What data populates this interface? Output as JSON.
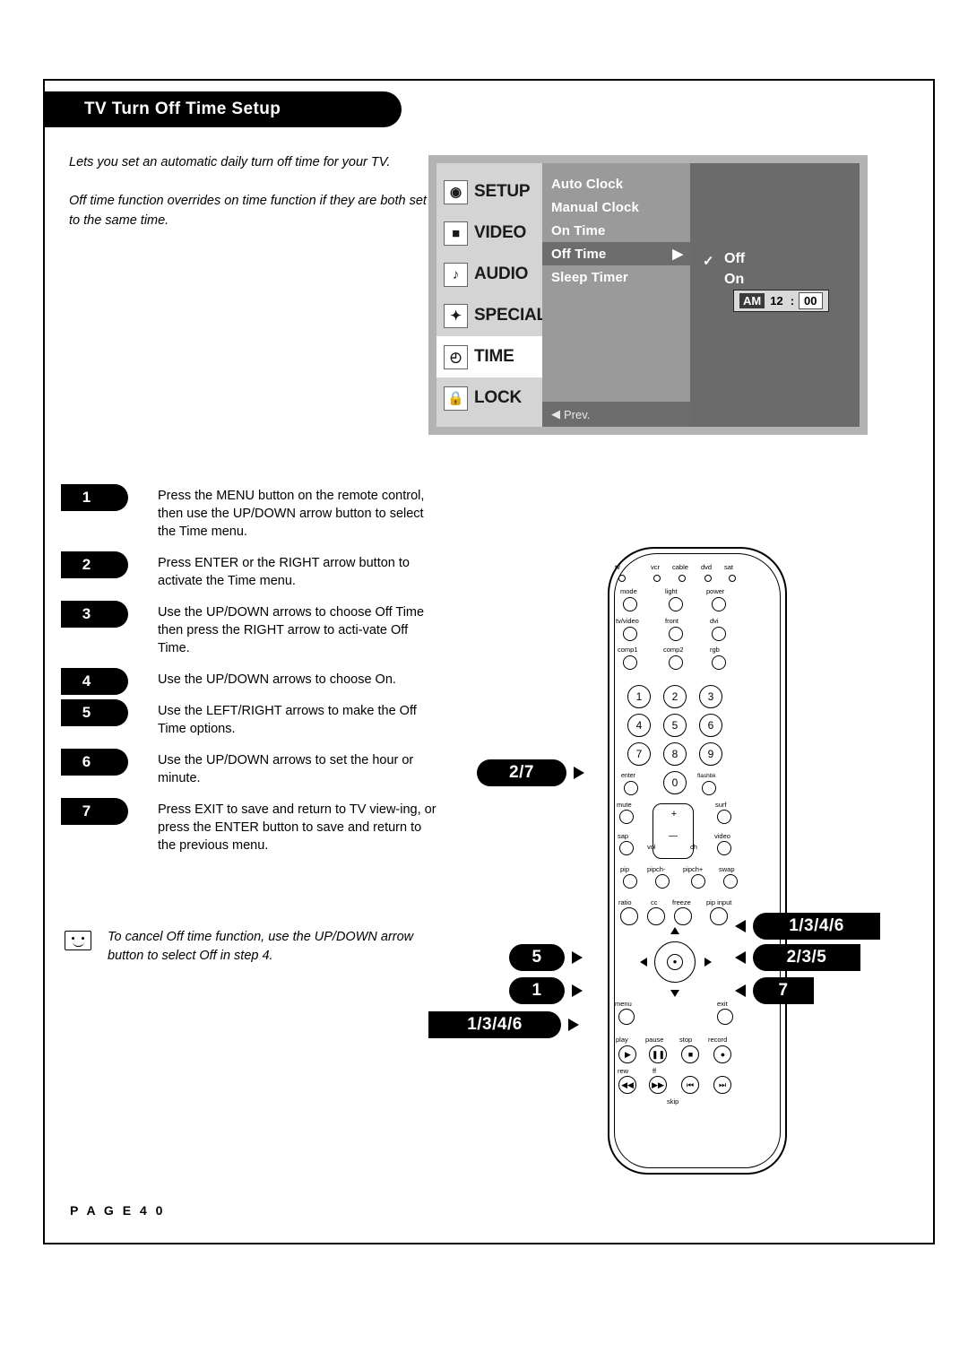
{
  "header": {
    "title": "TV Turn Off Time Setup"
  },
  "intro": {
    "p1": "Lets you set an automatic daily turn off time for your TV.",
    "p2": "Off time function overrides on time function if they are both set to the same time."
  },
  "osd": {
    "left_menu": [
      {
        "label": "SETUP",
        "icon": "satellite-dish-icon",
        "glyph": "☉",
        "selected": false
      },
      {
        "label": "VIDEO",
        "icon": "tv-screen-icon",
        "glyph": "■",
        "selected": false
      },
      {
        "label": "AUDIO",
        "icon": "speaker-icon",
        "glyph": "◉",
        "selected": false
      },
      {
        "label": "SPECIAL",
        "icon": "star-wand-icon",
        "glyph": "✦",
        "selected": false
      },
      {
        "label": "TIME",
        "icon": "clock-icon",
        "glyph": "◔",
        "selected": true
      },
      {
        "label": "LOCK",
        "icon": "padlock-icon",
        "glyph": "⌂",
        "selected": false
      }
    ],
    "mid_menu": [
      {
        "label": "Auto Clock",
        "selected": false
      },
      {
        "label": "Manual Clock",
        "selected": false
      },
      {
        "label": "On Time",
        "selected": false
      },
      {
        "label": "Off Time",
        "selected": true
      },
      {
        "label": "Sleep Timer",
        "selected": false
      }
    ],
    "prev_label": "Prev.",
    "options": [
      {
        "label": "Off",
        "checked": true
      },
      {
        "label": "On",
        "checked": false
      }
    ],
    "time": {
      "ampm": "AM",
      "hour": "12",
      "colon": ":",
      "minute": "00"
    }
  },
  "steps": [
    {
      "num": "1",
      "text": "Press the MENU button on the remote control, then use the UP/DOWN arrow button to select the Time menu."
    },
    {
      "num": "2",
      "text": "Press ENTER or the RIGHT arrow button to activate the Time menu."
    },
    {
      "num": "3",
      "text": "Use the UP/DOWN arrows to choose Off Time then press the RIGHT arrow to acti-vate Off Time."
    },
    {
      "num": "4",
      "text": "Use the UP/DOWN arrows to choose On."
    },
    {
      "num": "5",
      "text": "Use the LEFT/RIGHT arrows to make the Off Time options."
    },
    {
      "num": "6",
      "text": "Use the UP/DOWN arrows to set the hour or minute."
    },
    {
      "num": "7",
      "text": "Press EXIT to save and return to TV view-ing, or press the ENTER button to save and return to the previous menu."
    }
  ],
  "note": {
    "icon": "smiley-face-icon",
    "text": "To cancel Off time function, use the UP/DOWN arrow button to select Off in step 4."
  },
  "footer": {
    "page": "P A G E   4 0"
  },
  "callouts": [
    {
      "id": "callout-2-7",
      "label": "2/7"
    },
    {
      "id": "callout-1-3-4-6-right",
      "label": "1/3/4/6"
    },
    {
      "id": "callout-2-3-5",
      "label": "2/3/5"
    },
    {
      "id": "callout-5",
      "label": "5"
    },
    {
      "id": "callout-1",
      "label": "1"
    },
    {
      "id": "callout-7",
      "label": "7"
    },
    {
      "id": "callout-1-3-4-6-bottom",
      "label": "1/3/4/6"
    }
  ],
  "remote": {
    "device_row": [
      "tv",
      "vcr",
      "cable",
      "dvd",
      "sat"
    ],
    "row_mode": [
      "mode",
      "light",
      "power"
    ],
    "row_tvvideo": [
      "tv/video",
      "front",
      "dvi"
    ],
    "row_comp": [
      "comp1",
      "comp2",
      "rgb"
    ],
    "keypad": [
      "1",
      "2",
      "3",
      "4",
      "5",
      "6",
      "7",
      "8",
      "9",
      "enter",
      "0",
      "flashbk"
    ],
    "row_mute": [
      "mute",
      "surf"
    ],
    "row_sap": [
      "sap",
      "video"
    ],
    "vol_label": "vol",
    "ch_label": "ch",
    "plus": "+",
    "minus": "—",
    "row_pip": [
      "pip",
      "pipch-",
      "pipch+",
      "swap"
    ],
    "row_ratio": [
      "ratio",
      "cc",
      "freeze",
      "pip input"
    ],
    "menu_label": "menu",
    "exit_label": "exit",
    "transport_top": [
      "play",
      "pause",
      "stop",
      "record"
    ],
    "transport_bottom": [
      "rew",
      "ff"
    ],
    "skip_label": "skip"
  }
}
